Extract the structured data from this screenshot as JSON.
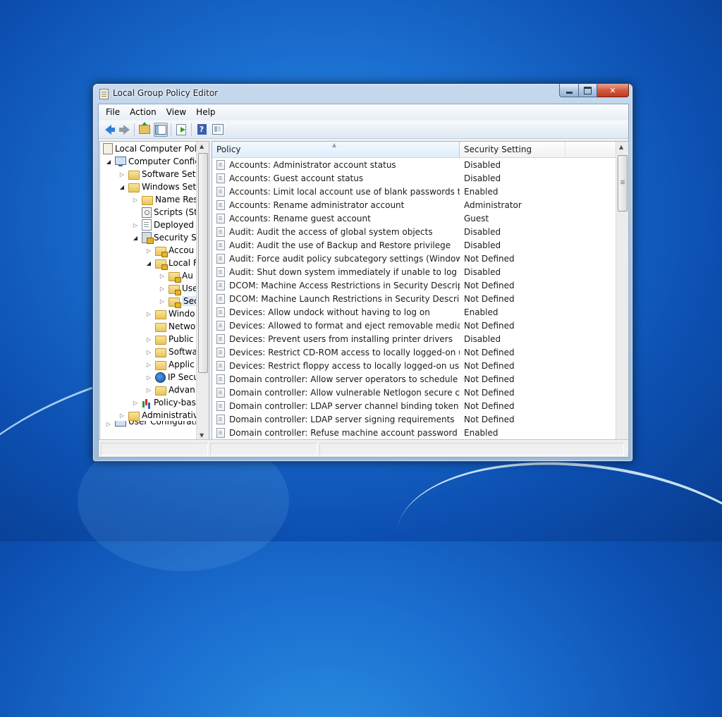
{
  "window": {
    "title": "Local Group Policy Editor"
  },
  "menu": [
    "File",
    "Action",
    "View",
    "Help"
  ],
  "toolbar": {
    "icons": [
      "back-icon",
      "forward-icon",
      "up-one-level-icon",
      "show-hide-console-tree-icon",
      "export-list-icon",
      "help-icon",
      "properties-icon"
    ]
  },
  "tree": [
    {
      "label": "Local Computer Polic",
      "icon": "policy-doc-icon"
    },
    {
      "label": "Computer Config",
      "icon": "computer-icon"
    },
    {
      "label": "Software Setti",
      "icon": "folder-icon"
    },
    {
      "label": "Windows Sett",
      "icon": "folder-icon"
    },
    {
      "label": "Name Res",
      "icon": "folder-icon"
    },
    {
      "label": "Scripts (Sta",
      "icon": "script-icon"
    },
    {
      "label": "Deployed",
      "icon": "printer-icon"
    },
    {
      "label": "Security Se",
      "icon": "security-icon"
    },
    {
      "label": "Accou",
      "icon": "lock-folder-icon"
    },
    {
      "label": "Local F",
      "icon": "lock-folder-icon"
    },
    {
      "label": "Au",
      "icon": "lock-folder-icon"
    },
    {
      "label": "Use",
      "icon": "lock-folder-icon"
    },
    {
      "label": "Sec",
      "icon": "lock-folder-icon"
    },
    {
      "label": "Windo",
      "icon": "folder-icon"
    },
    {
      "label": "Netwo",
      "icon": "folder-icon"
    },
    {
      "label": "Public",
      "icon": "folder-icon"
    },
    {
      "label": "Softwa",
      "icon": "folder-icon"
    },
    {
      "label": "Applic",
      "icon": "folder-icon"
    },
    {
      "label": "IP Secu",
      "icon": "ipsec-icon"
    },
    {
      "label": "Advan",
      "icon": "folder-icon"
    },
    {
      "label": "Policy-bas",
      "icon": "chart-icon"
    },
    {
      "label": "Administrative",
      "icon": "folder-icon"
    },
    {
      "label": "User Configuratio",
      "icon": "user-icon"
    }
  ],
  "list": {
    "columns": {
      "policy": "Policy",
      "setting": "Security Setting"
    },
    "rows": [
      {
        "policy": "Accounts: Administrator account status",
        "setting": "Disabled"
      },
      {
        "policy": "Accounts: Guest account status",
        "setting": "Disabled"
      },
      {
        "policy": "Accounts: Limit local account use of blank passwords to co...",
        "setting": "Enabled"
      },
      {
        "policy": "Accounts: Rename administrator account",
        "setting": "Administrator"
      },
      {
        "policy": "Accounts: Rename guest account",
        "setting": "Guest"
      },
      {
        "policy": "Audit: Audit the access of global system objects",
        "setting": "Disabled"
      },
      {
        "policy": "Audit: Audit the use of Backup and Restore privilege",
        "setting": "Disabled"
      },
      {
        "policy": "Audit: Force audit policy subcategory settings (Windows Vis...",
        "setting": "Not Defined"
      },
      {
        "policy": "Audit: Shut down system immediately if unable to log secur...",
        "setting": "Disabled"
      },
      {
        "policy": "DCOM: Machine Access Restrictions in Security Descriptor D...",
        "setting": "Not Defined"
      },
      {
        "policy": "DCOM: Machine Launch Restrictions in Security Descriptor ...",
        "setting": "Not Defined"
      },
      {
        "policy": "Devices: Allow undock without having to log on",
        "setting": "Enabled"
      },
      {
        "policy": "Devices: Allowed to format and eject removable media",
        "setting": "Not Defined"
      },
      {
        "policy": "Devices: Prevent users from installing printer drivers",
        "setting": "Disabled"
      },
      {
        "policy": "Devices: Restrict CD-ROM access to locally logged-on user ...",
        "setting": "Not Defined"
      },
      {
        "policy": "Devices: Restrict floppy access to locally logged-on user only",
        "setting": "Not Defined"
      },
      {
        "policy": "Domain controller: Allow server operators to schedule tasks",
        "setting": "Not Defined"
      },
      {
        "policy": "Domain controller: Allow vulnerable Netlogon secure chann...",
        "setting": "Not Defined"
      },
      {
        "policy": "Domain controller: LDAP server channel binding token requi...",
        "setting": "Not Defined"
      },
      {
        "policy": "Domain controller: LDAP server signing requirements",
        "setting": "Not Defined"
      },
      {
        "policy": "Domain controller: Refuse machine account password chan...",
        "setting": "Enabled"
      }
    ]
  }
}
